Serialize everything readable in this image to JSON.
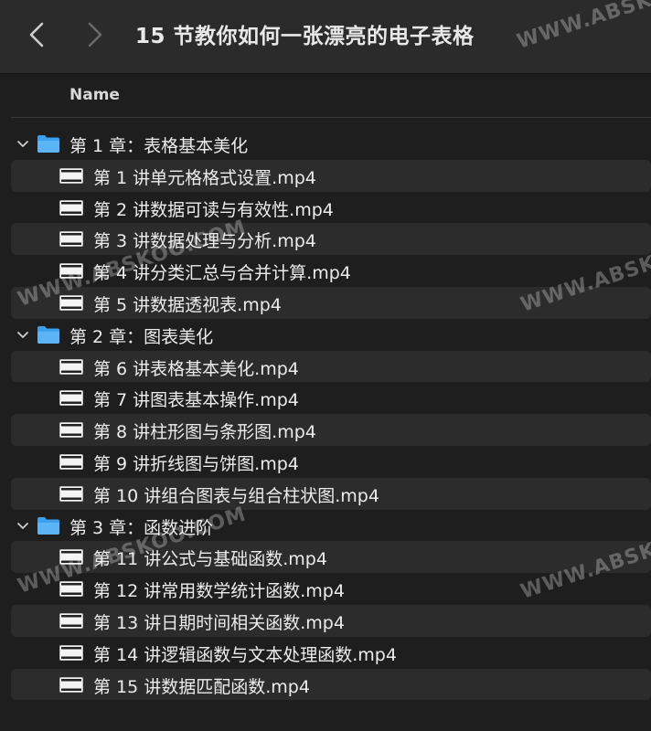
{
  "window": {
    "title": "15 节教你如何一张漂亮的电子表格"
  },
  "header": {
    "name_column": "Name"
  },
  "items": [
    {
      "type": "folder",
      "label": "第 1 章：表格基本美化"
    },
    {
      "type": "file",
      "label": "第 1 讲单元格格式设置.mp4"
    },
    {
      "type": "file",
      "label": "第 2 讲数据可读与有效性.mp4"
    },
    {
      "type": "file",
      "label": "第 3 讲数据处理与分析.mp4"
    },
    {
      "type": "file",
      "label": "第 4 讲分类汇总与合并计算.mp4"
    },
    {
      "type": "file",
      "label": "第 5 讲数据透视表.mp4"
    },
    {
      "type": "folder",
      "label": "第 2 章：图表美化"
    },
    {
      "type": "file",
      "label": "第 6 讲表格基本美化.mp4"
    },
    {
      "type": "file",
      "label": "第 7 讲图表基本操作.mp4"
    },
    {
      "type": "file",
      "label": "第 8 讲柱形图与条形图.mp4"
    },
    {
      "type": "file",
      "label": "第 9 讲折线图与饼图.mp4"
    },
    {
      "type": "file",
      "label": "第 10 讲组合图表与组合柱状图.mp4"
    },
    {
      "type": "folder",
      "label": "第 3 章：函数进阶"
    },
    {
      "type": "file",
      "label": "第 11 讲公式与基础函数.mp4"
    },
    {
      "type": "file",
      "label": "第 12 讲常用数学统计函数.mp4"
    },
    {
      "type": "file",
      "label": "第 13 讲日期时间相关函数.mp4"
    },
    {
      "type": "file",
      "label": "第 14 讲逻辑函数与文本处理函数.mp4"
    },
    {
      "type": "file",
      "label": "第 15 讲数据匹配函数.mp4"
    }
  ],
  "watermarks": [
    "WWW.ABSKOO.COM",
    "WWW.ABSKOO.COM",
    "WWW.ABSKOO.COM",
    "WWW.ABSKOO.COM",
    "WWW.ABSKOO.COM"
  ],
  "colors": {
    "folder": "#3ba0f0",
    "background": "#1e1e1e",
    "stripe": "#2c2c2c"
  },
  "icons": {
    "back": "chevron-left-icon",
    "forward": "chevron-right-icon",
    "expand": "chevron-down-icon",
    "folder": "folder-icon",
    "file": "video-file-icon"
  }
}
